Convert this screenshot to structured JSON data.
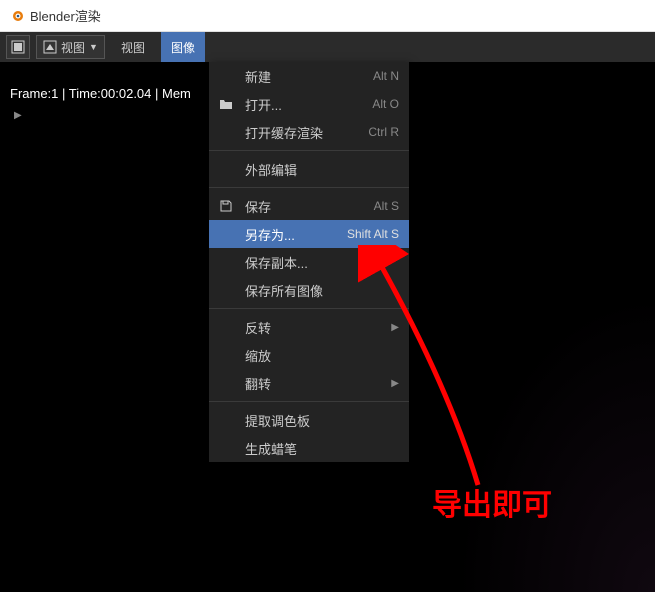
{
  "title": "Blender渲染",
  "toolbar": {
    "view_mode": "视图",
    "view_menu": "视图",
    "image_menu": "图像"
  },
  "status": "Frame:1 | Time:00:02.04 | Mem",
  "menu": {
    "new": {
      "label": "新建",
      "shortcut": "Alt N"
    },
    "open": {
      "label": "打开...",
      "shortcut": "Alt O"
    },
    "open_cached": {
      "label": "打开缓存渲染",
      "shortcut": "Ctrl R"
    },
    "external_edit": {
      "label": "外部编辑"
    },
    "save": {
      "label": "保存",
      "shortcut": "Alt S"
    },
    "save_as": {
      "label": "另存为...",
      "shortcut": "Shift Alt S"
    },
    "save_copy": {
      "label": "保存副本..."
    },
    "save_all": {
      "label": "保存所有图像"
    },
    "invert": {
      "label": "反转"
    },
    "resize": {
      "label": "缩放"
    },
    "flip": {
      "label": "翻转"
    },
    "extract_palette": {
      "label": "提取调色板"
    },
    "gen_grease": {
      "label": "生成蜡笔"
    }
  },
  "annotation": "导出即可"
}
